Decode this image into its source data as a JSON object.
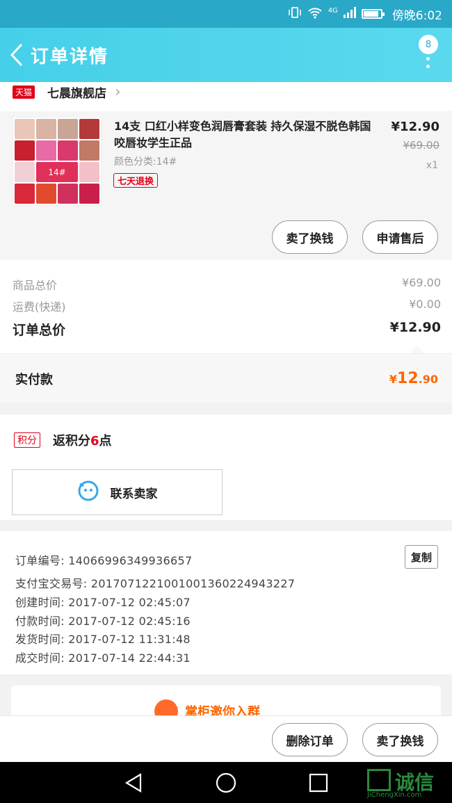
{
  "status_bar": {
    "carrier": "4G",
    "time": "傍晚6:02"
  },
  "header": {
    "title": "订单详情",
    "badge_count": "8"
  },
  "store": {
    "platform_badge": "天猫",
    "name": "七晨旗舰店"
  },
  "product": {
    "title": "14支 口红小样变色润唇膏套装 持久保湿不脱色韩国咬唇妆学生正品",
    "variant": "颜色分类:14#",
    "tag": "七天退换",
    "thumb_label": "14#",
    "price": "¥12.90",
    "original_price": "¥69.00",
    "quantity": "x1",
    "btn_buy_more": "卖了换钱",
    "btn_after_sale": "申请售后"
  },
  "summary": {
    "goods_label": "商品总价",
    "goods_value": "¥69.00",
    "shipping_label": "运费(快递)",
    "shipping_value": "¥0.00",
    "total_label": "订单总价",
    "total_value": "¥12.90"
  },
  "paid": {
    "label": "实付款",
    "currency": "¥",
    "integer": "12",
    "decimal": ".90"
  },
  "points": {
    "badge": "积分",
    "text_prefix": "返积分",
    "text_num": "6",
    "text_suffix": "点",
    "contact_label": "联系卖家"
  },
  "order_info": {
    "lines": [
      "订单编号: 14066996349936657",
      "支付宝交易号: 2017071221001001360224943227",
      "创建时间: 2017-07-12 02:45:07",
      "付款时间: 2017-07-12 02:45:16",
      "发货时间: 2017-07-12 11:31:48",
      "成交时间: 2017-07-14 22:44:31"
    ],
    "copy_label": "复制"
  },
  "promo": {
    "text": "掌柜邀你入群"
  },
  "bottom": {
    "delete_label": "删除订单",
    "sell_label": "卖了换钱"
  },
  "watermark": {
    "text": "诚信",
    "sub": "JiChengXin.com"
  },
  "colors": {
    "accent": "#46cfe9",
    "price_orange": "#ff6600",
    "tmall_red": "#e0001a"
  }
}
